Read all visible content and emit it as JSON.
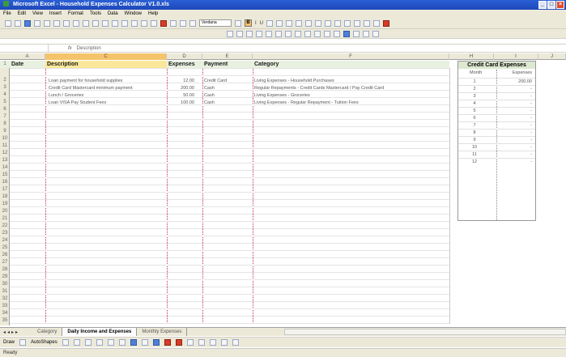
{
  "window": {
    "title": "Microsoft Excel - Household Expenses Calculator V1.0.xls"
  },
  "menu": [
    "File",
    "Edit",
    "View",
    "Insert",
    "Format",
    "Tools",
    "Data",
    "Window",
    "Help"
  ],
  "toolbar": {
    "font_name": "Verdana",
    "bold_label": "B",
    "italic_label": "I",
    "underline_label": "U"
  },
  "formula_bar": {
    "fx": "fx",
    "content": "Description"
  },
  "columns": [
    "A",
    "C",
    "D",
    "E",
    "F",
    "H",
    "I",
    "J"
  ],
  "headers": {
    "date": "Date",
    "description": "Description",
    "expenses": "Expenses",
    "payment": "Payment",
    "category": "Category"
  },
  "rows": [
    {
      "num": "1"
    },
    {
      "num": "2",
      "description": "Loan payment for household supplies",
      "expenses": "12.00",
      "payment": "Credit Card",
      "category": "Living Expenses - Household Purchases"
    },
    {
      "num": "3",
      "description": "Credit Card Mastercard minimum payment",
      "expenses": "200.00",
      "payment": "Cash",
      "category": "Regular Repayments - Credit Cards Mastercard / Pay Credit Card"
    },
    {
      "num": "4",
      "description": "Lunch / Groceries",
      "expenses": "50.00",
      "payment": "Cash",
      "category": "Living Expenses - Groceries"
    },
    {
      "num": "5",
      "description": "Loan VISA Pay Student Fees",
      "expenses": "100.00",
      "payment": "Cash",
      "category": "Living Expenses - Regular Repayment - Tuition Fees"
    }
  ],
  "row_numbers": [
    "6",
    "7",
    "8",
    "9",
    "10",
    "11",
    "12",
    "13",
    "14",
    "15",
    "16",
    "17",
    "18",
    "19",
    "20",
    "21",
    "22",
    "23",
    "24",
    "25",
    "26",
    "27",
    "28",
    "29",
    "30",
    "31",
    "32",
    "33",
    "34",
    "35",
    "36",
    "37"
  ],
  "credit_card": {
    "title": "Credit Card Expenses",
    "month_label": "Month",
    "expenses_label": "Expenses",
    "rows": [
      {
        "month": "1",
        "value": "200.00"
      },
      {
        "month": "2",
        "value": "-"
      },
      {
        "month": "3",
        "value": "-"
      },
      {
        "month": "4",
        "value": "-"
      },
      {
        "month": "5",
        "value": "-"
      },
      {
        "month": "6",
        "value": "-"
      },
      {
        "month": "7",
        "value": "-"
      },
      {
        "month": "8",
        "value": "-"
      },
      {
        "month": "9",
        "value": "-"
      },
      {
        "month": "10",
        "value": "-"
      },
      {
        "month": "11",
        "value": "-"
      },
      {
        "month": "12",
        "value": "-"
      }
    ]
  },
  "tabs": [
    "Category",
    "Daily Income and Expenses",
    "Monthly Expenses"
  ],
  "drawbar": {
    "draw": "Draw",
    "autoshapes": "AutoShapes"
  },
  "status": "Ready"
}
